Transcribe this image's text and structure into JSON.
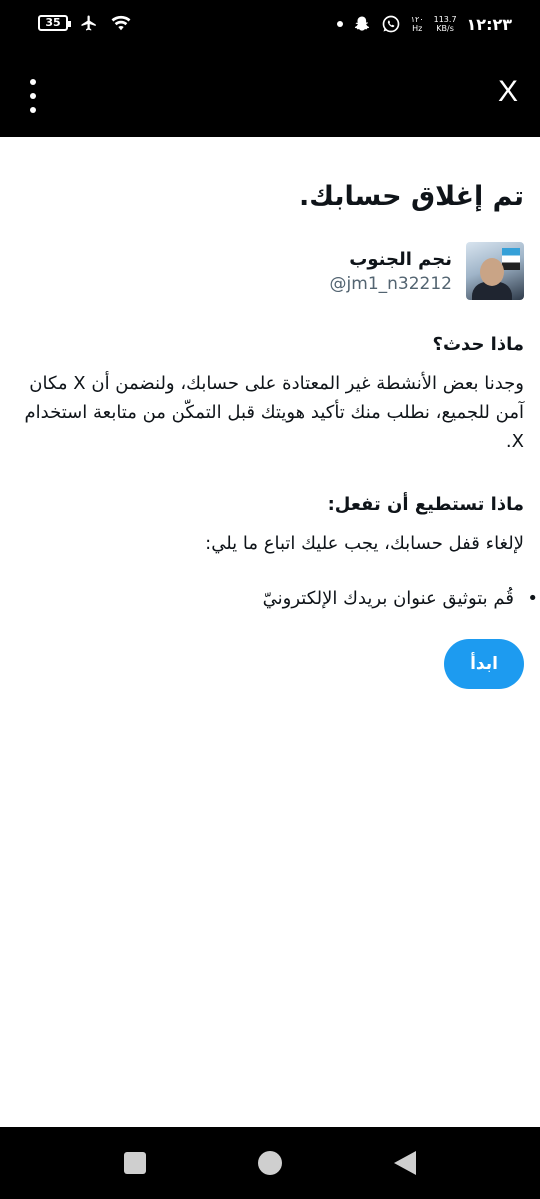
{
  "status_bar": {
    "battery": "35",
    "speed_value": "113.7",
    "speed_unit": "KB/s",
    "hz_value": "١٢٠",
    "hz_unit": "Hz",
    "time": "١٢:٢٣"
  },
  "top_bar": {
    "close_label": "X"
  },
  "page": {
    "title": "تم إغلاق حسابك.",
    "profile": {
      "display_name": "نجم الجنوب",
      "handle": "@jm1_n32212"
    },
    "what_happened": {
      "heading": "ماذا حدث؟",
      "text": "وجدنا بعض الأنشطة غير المعتادة على حسابك، ولنضمن أن X مكان آمن للجميع، نطلب منك تأكيد هويتك قبل التمكّن من متابعة استخدام X."
    },
    "what_to_do": {
      "heading": "ماذا تستطيع أن تفعل:",
      "text": "لإلغاء قفل حسابك، يجب عليك اتباع ما يلي:",
      "steps": [
        "قُم بتوثيق عنوان بريدك الإلكترونيّ"
      ]
    },
    "start_button": "ابدأ"
  },
  "colors": {
    "accent": "#1d9bf0",
    "text": "#0f1419",
    "muted": "#536471",
    "bars": "#000000"
  }
}
